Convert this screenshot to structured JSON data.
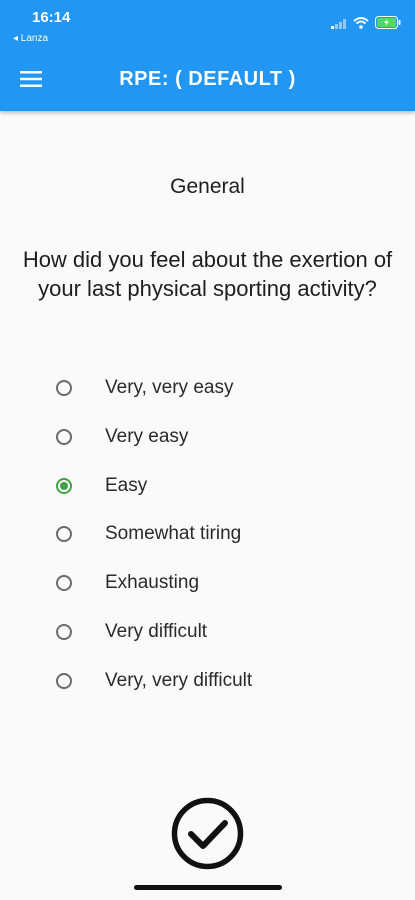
{
  "status_bar": {
    "time": "16:14",
    "back_label": "◂ Lanza"
  },
  "app_bar": {
    "title": "RPE: ( DEFAULT )",
    "menu_icon": "hamburger-menu-icon",
    "background_color": "#2196f3"
  },
  "section": {
    "title": "General"
  },
  "question": {
    "text": "How did you feel about the exertion of your last physical sporting activity?"
  },
  "options": [
    {
      "label": "Very, very easy",
      "selected": false
    },
    {
      "label": "Very easy",
      "selected": false
    },
    {
      "label": "Easy",
      "selected": true
    },
    {
      "label": "Somewhat tiring",
      "selected": false
    },
    {
      "label": "Exhausting",
      "selected": false
    },
    {
      "label": "Very difficult",
      "selected": false
    },
    {
      "label": "Very, very difficult",
      "selected": false
    }
  ],
  "colors": {
    "selected_radio": "#43a047"
  },
  "submit": {
    "icon": "check-circle-icon"
  }
}
